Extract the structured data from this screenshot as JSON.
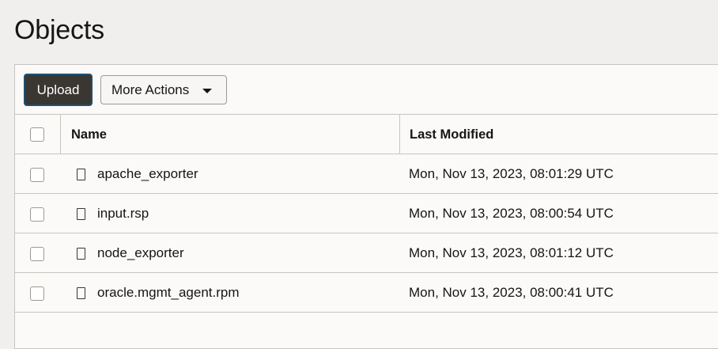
{
  "page": {
    "title": "Objects"
  },
  "toolbar": {
    "upload_label": "Upload",
    "more_actions_label": "More Actions"
  },
  "table": {
    "columns": [
      "Name",
      "Last Modified"
    ],
    "rows": [
      {
        "name": "apache_exporter",
        "last_modified": "Mon, Nov 13, 2023, 08:01:29 UTC",
        "icon": "file-icon"
      },
      {
        "name": "input.rsp",
        "last_modified": "Mon, Nov 13, 2023, 08:00:54 UTC",
        "icon": "file-icon"
      },
      {
        "name": "node_exporter",
        "last_modified": "Mon, Nov 13, 2023, 08:01:12 UTC",
        "icon": "file-icon"
      },
      {
        "name": "oracle.mgmt_agent.rpm",
        "last_modified": "Mon, Nov 13, 2023, 08:00:41 UTC",
        "icon": "file-icon"
      }
    ]
  },
  "colors": {
    "background": "#f1efed",
    "panel": "#fbfaf9",
    "primary_button": "#3a3632",
    "border": "#c8c4bf"
  }
}
